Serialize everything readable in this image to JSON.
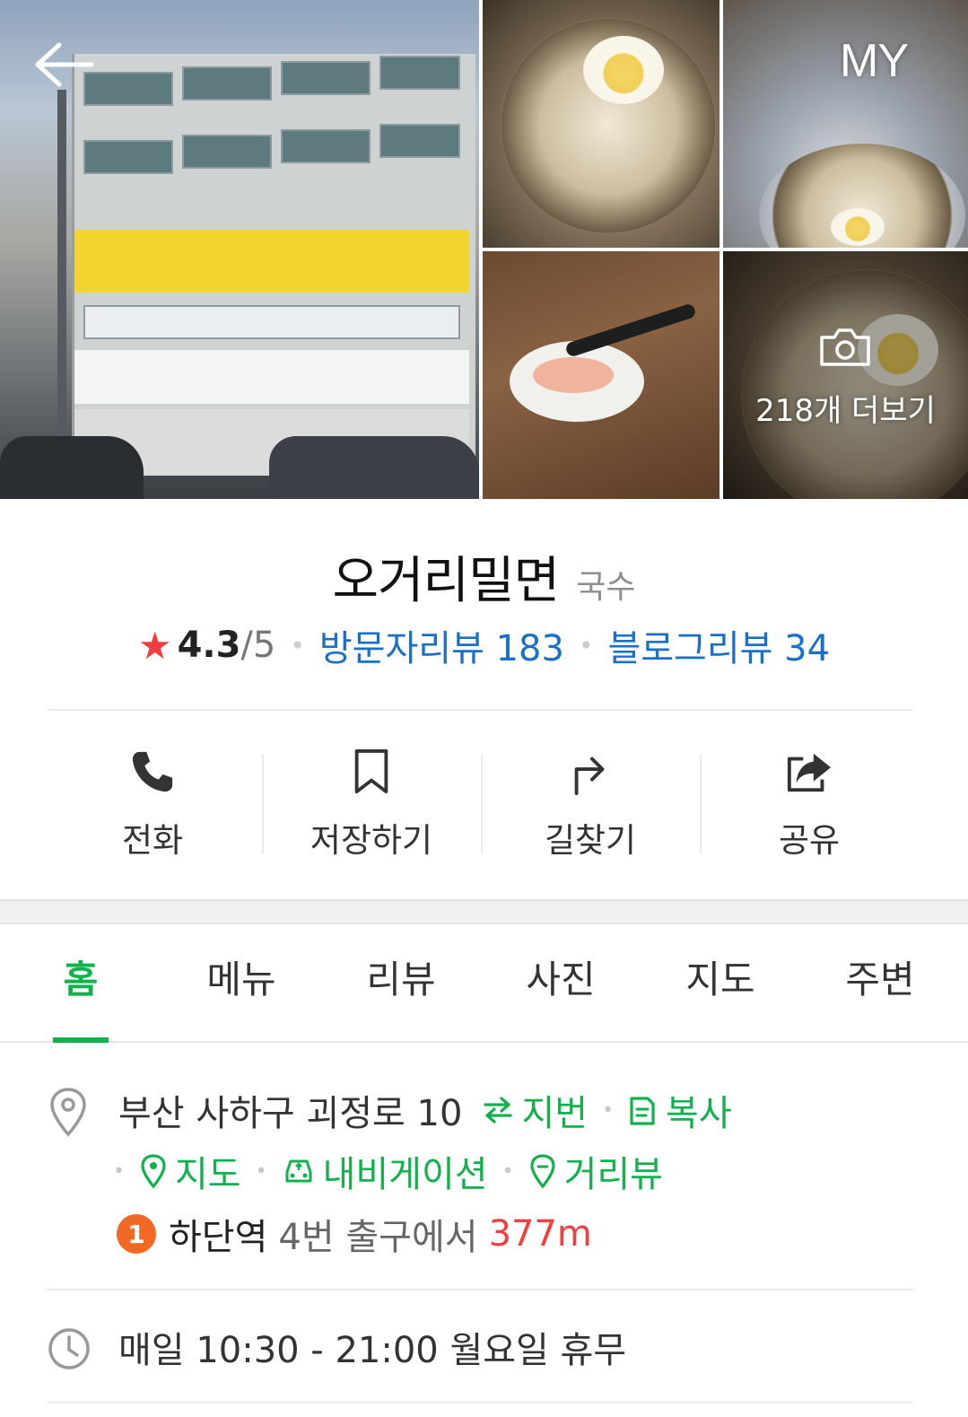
{
  "header": {
    "back_icon": "arrow-left-icon",
    "my_label": "MY",
    "more_photos_label": "218개 더보기",
    "camera_icon": "camera-icon"
  },
  "place": {
    "name": "오거리밀면",
    "category": "국수",
    "rating": "4.3",
    "rating_max": "/5",
    "visitor_reviews": "방문자리뷰 183",
    "blog_reviews": "블로그리뷰 34"
  },
  "actions": [
    {
      "label": "전화",
      "icon": "phone-icon"
    },
    {
      "label": "저장하기",
      "icon": "bookmark-icon"
    },
    {
      "label": "길찾기",
      "icon": "directions-icon"
    },
    {
      "label": "공유",
      "icon": "share-icon"
    }
  ],
  "tabs": [
    "홈",
    "메뉴",
    "리뷰",
    "사진",
    "지도",
    "주변"
  ],
  "active_tab": "홈",
  "info": {
    "address": "부산 사하구 괴정로 10",
    "jibun_label": "지번",
    "copy_label": "복사",
    "map_label": "지도",
    "navigation_label": "내비게이션",
    "roadview_label": "거리뷰",
    "subway_line": "1",
    "station": "하단역",
    "exit_text": "4번 출구에서",
    "distance": "377m",
    "hours": "매일 10:30 - 21:00 월요일 휴무"
  },
  "colors": {
    "accent_green": "#12b14e",
    "link_blue": "#1a6fc8",
    "star_red": "#f03e3e",
    "subway_line1": "#f06a26"
  }
}
